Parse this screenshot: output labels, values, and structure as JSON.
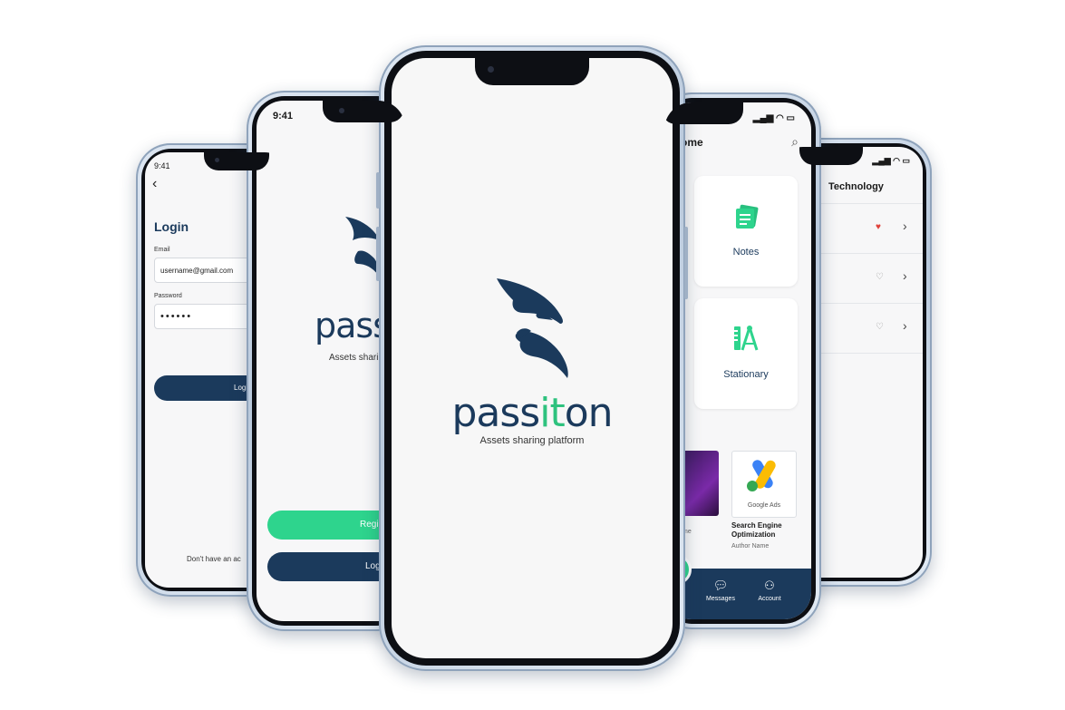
{
  "login_screen": {
    "time": "9:41",
    "title": "Login",
    "email_label": "Email",
    "email_value": "username@gmail.com",
    "password_label": "Password",
    "password_value": "••••••",
    "login_button": "Logi",
    "footer_text": "Don't have an ac"
  },
  "welcome_screen": {
    "time": "9:41",
    "brand": "pass",
    "tagline": "Assets sharing",
    "register_button": "Regi",
    "login_button": "Log"
  },
  "splash_screen": {
    "brand_prefix": "pass",
    "brand_accent": "it",
    "brand_suffix": "on",
    "tagline": "Assets sharing platform"
  },
  "home_screen": {
    "title": "ome",
    "categories": [
      {
        "label": "Notes",
        "icon": "notes-icon"
      },
      {
        "label": "Stationary",
        "icon": "stationary-icon"
      }
    ],
    "cards": [
      {
        "title": "me",
        "subtitle": ""
      },
      {
        "title": "Search Engine Optimization",
        "subtitle": "Author Name",
        "thumb_label": "Google Ads"
      }
    ],
    "nav": [
      {
        "label": "Messages",
        "icon": "message-icon"
      },
      {
        "label": "Account",
        "icon": "account-icon"
      }
    ]
  },
  "list_screen": {
    "title": "Technology",
    "items": [
      {
        "favorite": true
      },
      {
        "favorite": false
      },
      {
        "favorite": false
      }
    ]
  },
  "colors": {
    "navy": "#1b3a5c",
    "green": "#2ed48d",
    "accent_green": "#2ec27e",
    "heart_red": "#e0413a"
  }
}
